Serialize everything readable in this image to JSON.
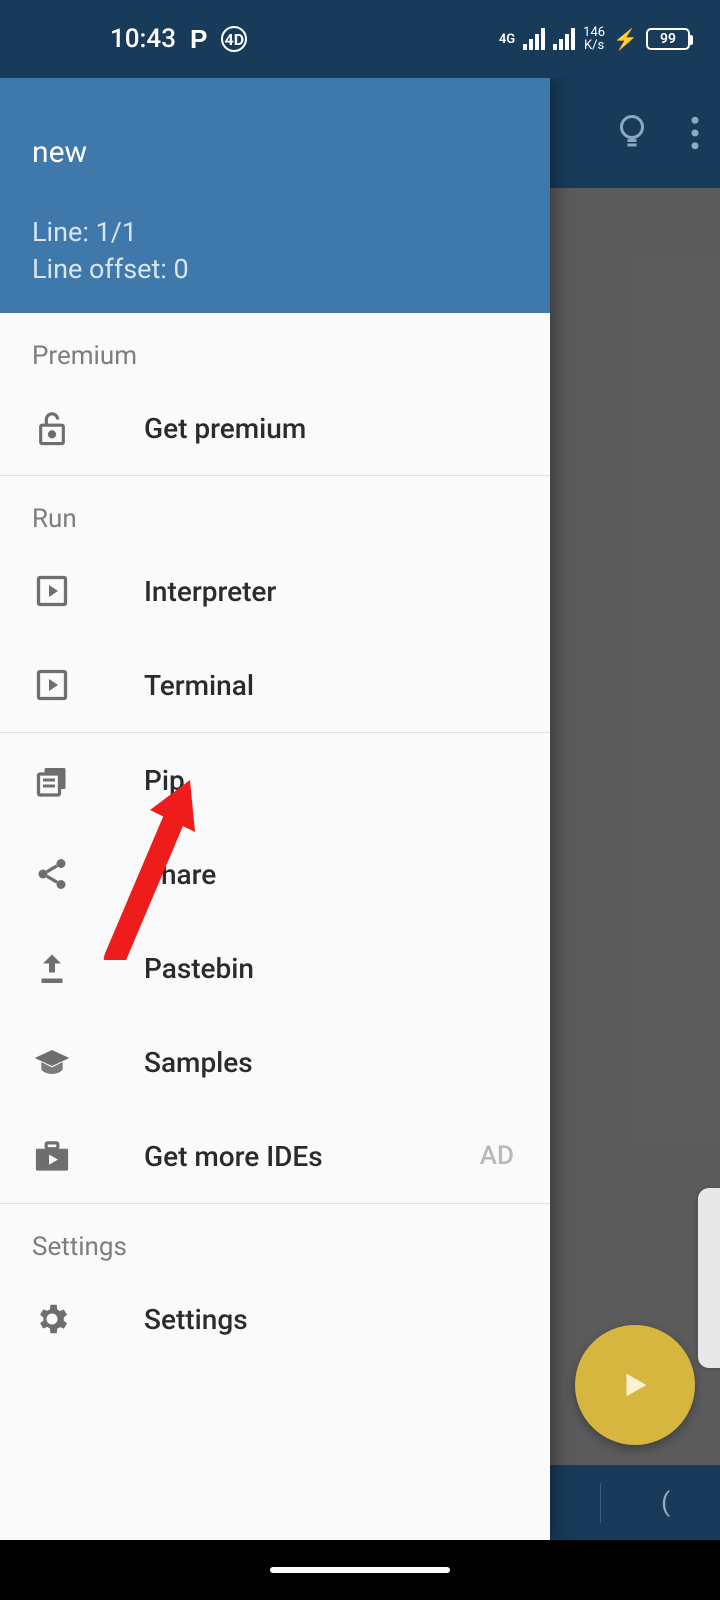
{
  "status": {
    "time": "10:43",
    "net_label": "4G",
    "rate_top": "146",
    "rate_bottom": "K/s",
    "battery_pct": "99"
  },
  "drawer": {
    "title": "new",
    "line_text": "Line: 1/1",
    "offset_text": "Line offset: 0",
    "sections": {
      "premium_label": "Premium",
      "run_label": "Run",
      "settings_label": "Settings"
    },
    "items": {
      "get_premium": "Get premium",
      "interpreter": "Interpreter",
      "terminal": "Terminal",
      "pip": "Pip",
      "share": "Share",
      "pastebin": "Pastebin",
      "samples": "Samples",
      "more_ides": "Get more IDEs",
      "more_ides_ad": "AD",
      "settings": "Settings"
    }
  },
  "bottom_keys": {
    "hash": "#",
    "paren": "("
  }
}
